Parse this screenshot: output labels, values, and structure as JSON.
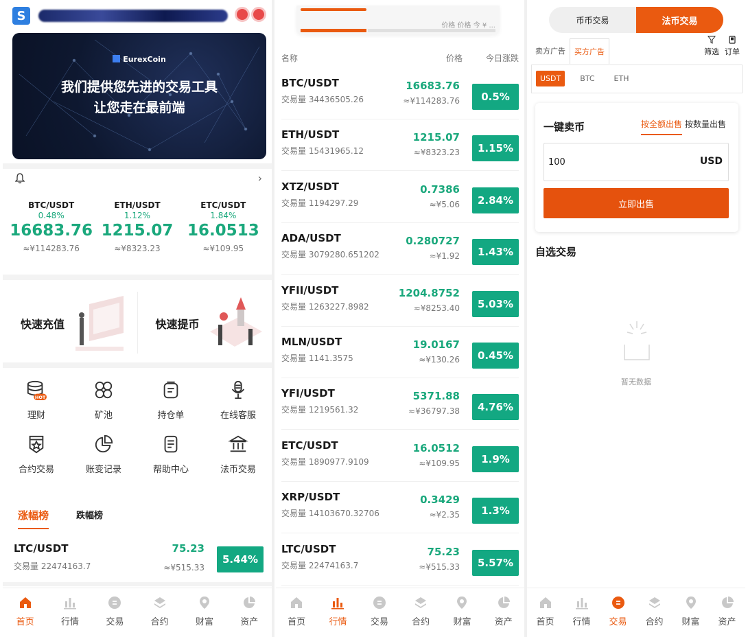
{
  "home": {
    "banner": {
      "logo_text": "EurexCoin",
      "line1": "我们提供您先进的交易工具",
      "line2": "让您走在最前端"
    },
    "tickers": [
      {
        "pair": "BTC/USDT",
        "change": "0.48%",
        "price": "16683.76",
        "cny": "≈¥114283.76"
      },
      {
        "pair": "ETH/USDT",
        "change": "1.12%",
        "price": "1215.07",
        "cny": "≈¥8323.23"
      },
      {
        "pair": "ETC/USDT",
        "change": "1.84%",
        "price": "16.0513",
        "cny": "≈¥109.95"
      }
    ],
    "quick": {
      "deposit": "快速充值",
      "withdraw": "快速提币"
    },
    "grid": [
      {
        "label": "理财",
        "icon": "coins-hot-icon"
      },
      {
        "label": "矿池",
        "icon": "pool-icon"
      },
      {
        "label": "持仓单",
        "icon": "position-icon"
      },
      {
        "label": "在线客服",
        "icon": "microphone-icon"
      },
      {
        "label": "合约交易",
        "icon": "contract-icon"
      },
      {
        "label": "账变记录",
        "icon": "pie-record-icon"
      },
      {
        "label": "帮助中心",
        "icon": "document-icon"
      },
      {
        "label": "法币交易",
        "icon": "bank-icon"
      }
    ],
    "hot_badge": "HOT",
    "rank_tabs": {
      "gainers": "涨幅榜",
      "losers": "跌幅榜"
    },
    "rank_row": {
      "pair": "LTC/USDT",
      "volume": "交易量 22474163.7",
      "price": "75.23",
      "cny": "≈¥515.33",
      "change": "5.44%"
    }
  },
  "market": {
    "top_text": "价格  价格  今 ¥ ...",
    "headers": {
      "name": "名称",
      "price": "价格",
      "change": "今日涨跌"
    },
    "rows": [
      {
        "pair": "BTC/USDT",
        "volume": "交易量 34436505.26",
        "price": "16683.76",
        "cny": "≈¥114283.76",
        "change": "0.5%"
      },
      {
        "pair": "ETH/USDT",
        "volume": "交易量 15431965.12",
        "price": "1215.07",
        "cny": "≈¥8323.23",
        "change": "1.15%"
      },
      {
        "pair": "XTZ/USDT",
        "volume": "交易量 1194297.29",
        "price": "0.7386",
        "cny": "≈¥5.06",
        "change": "2.84%"
      },
      {
        "pair": "ADA/USDT",
        "volume": "交易量 3079280.651202",
        "price": "0.280727",
        "cny": "≈¥1.92",
        "change": "1.43%"
      },
      {
        "pair": "YFII/USDT",
        "volume": "交易量 1263227.8982",
        "price": "1204.8752",
        "cny": "≈¥8253.40",
        "change": "5.03%"
      },
      {
        "pair": "MLN/USDT",
        "volume": "交易量 1141.3575",
        "price": "19.0167",
        "cny": "≈¥130.26",
        "change": "0.45%"
      },
      {
        "pair": "YFI/USDT",
        "volume": "交易量 1219561.32",
        "price": "5371.88",
        "cny": "≈¥36797.38",
        "change": "4.76%"
      },
      {
        "pair": "ETC/USDT",
        "volume": "交易量 1890977.9109",
        "price": "16.0512",
        "cny": "≈¥109.95",
        "change": "1.9%"
      },
      {
        "pair": "XRP/USDT",
        "volume": "交易量 14103670.32706",
        "price": "0.3429",
        "cny": "≈¥2.35",
        "change": "1.3%"
      },
      {
        "pair": "LTC/USDT",
        "volume": "交易量 22474163.7",
        "price": "75.23",
        "cny": "≈¥515.33",
        "change": "5.57%"
      }
    ]
  },
  "otc": {
    "segments": {
      "coin": "币币交易",
      "fiat": "法币交易"
    },
    "ad_tabs": {
      "sell": "卖方广告",
      "buy": "买方广告"
    },
    "tools": {
      "filter": "筛选",
      "orders": "订单"
    },
    "currencies": [
      "USDT",
      "BTC",
      "ETH"
    ],
    "sell_card": {
      "title": "一键卖币",
      "tab_amount": "按全额出售",
      "tab_qty": "按数量出售",
      "input_value": "100",
      "unit": "USD",
      "button": "立即出售"
    },
    "watch_title": "自选交易",
    "empty_text": "暂无数据"
  },
  "tabbar": [
    {
      "label": "首页",
      "icon": "home-icon"
    },
    {
      "label": "行情",
      "icon": "chart-bars-icon"
    },
    {
      "label": "交易",
      "icon": "trade-icon"
    },
    {
      "label": "合约",
      "icon": "layers-icon"
    },
    {
      "label": "财富",
      "icon": "location-icon"
    },
    {
      "label": "资产",
      "icon": "pie-icon"
    }
  ],
  "colors": {
    "accent": "#ea5a10",
    "up": "#1aa87c",
    "badge": "#13a882",
    "inactive_icon": "#c8c8c8"
  }
}
